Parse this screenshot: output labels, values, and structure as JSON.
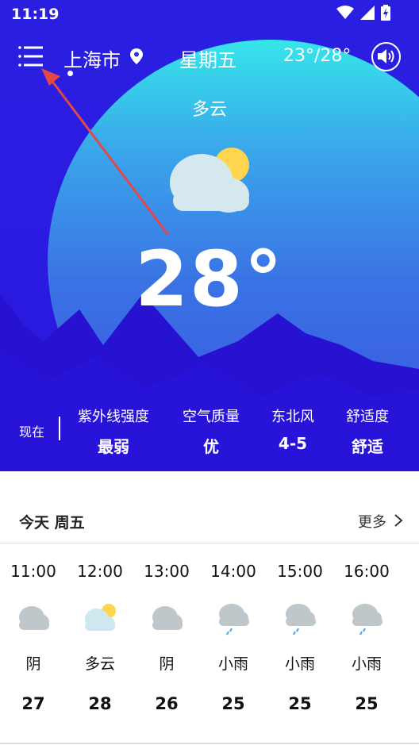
{
  "status_bar": {
    "time": "11:19",
    "icons": [
      "wifi-icon",
      "signal-icon",
      "battery-charging-icon"
    ]
  },
  "header": {
    "city": "上海市",
    "weekday": "星期五",
    "temp_range": "23°/28°",
    "icons": [
      "menu-icon",
      "location-pin-icon",
      "speaker-icon"
    ]
  },
  "current": {
    "condition": "多云",
    "temperature": "28°",
    "icon": "partly-cloudy-icon"
  },
  "indices": {
    "now_label": "现在",
    "items": [
      {
        "title": "紫外线强度",
        "value": "最弱"
      },
      {
        "title": "空气质量",
        "value": "优"
      },
      {
        "title": "东北风",
        "value": "4-5"
      },
      {
        "title": "舒适度",
        "value": "舒适"
      }
    ]
  },
  "forecast": {
    "today_label": "今天 周五",
    "more_label": "更多",
    "hours": [
      {
        "time": "11:00",
        "icon": "overcast-icon",
        "condition": "阴",
        "temp": "27"
      },
      {
        "time": "12:00",
        "icon": "partly-cloudy-icon",
        "condition": "多云",
        "temp": "28"
      },
      {
        "time": "13:00",
        "icon": "overcast-icon",
        "condition": "阴",
        "temp": "26"
      },
      {
        "time": "14:00",
        "icon": "light-rain-icon",
        "condition": "小雨",
        "temp": "25"
      },
      {
        "time": "15:00",
        "icon": "light-rain-icon",
        "condition": "小雨",
        "temp": "25"
      },
      {
        "time": "16:00",
        "icon": "light-rain-icon",
        "condition": "小雨",
        "temp": "25"
      }
    ]
  },
  "colors": {
    "hero_deep": "#2a1fe0",
    "hero_light": "#36e6ea",
    "mountain": "#2410c8",
    "sun": "#ffd54f",
    "cloud": "#cfe8ef",
    "arrow": "#e34848"
  }
}
